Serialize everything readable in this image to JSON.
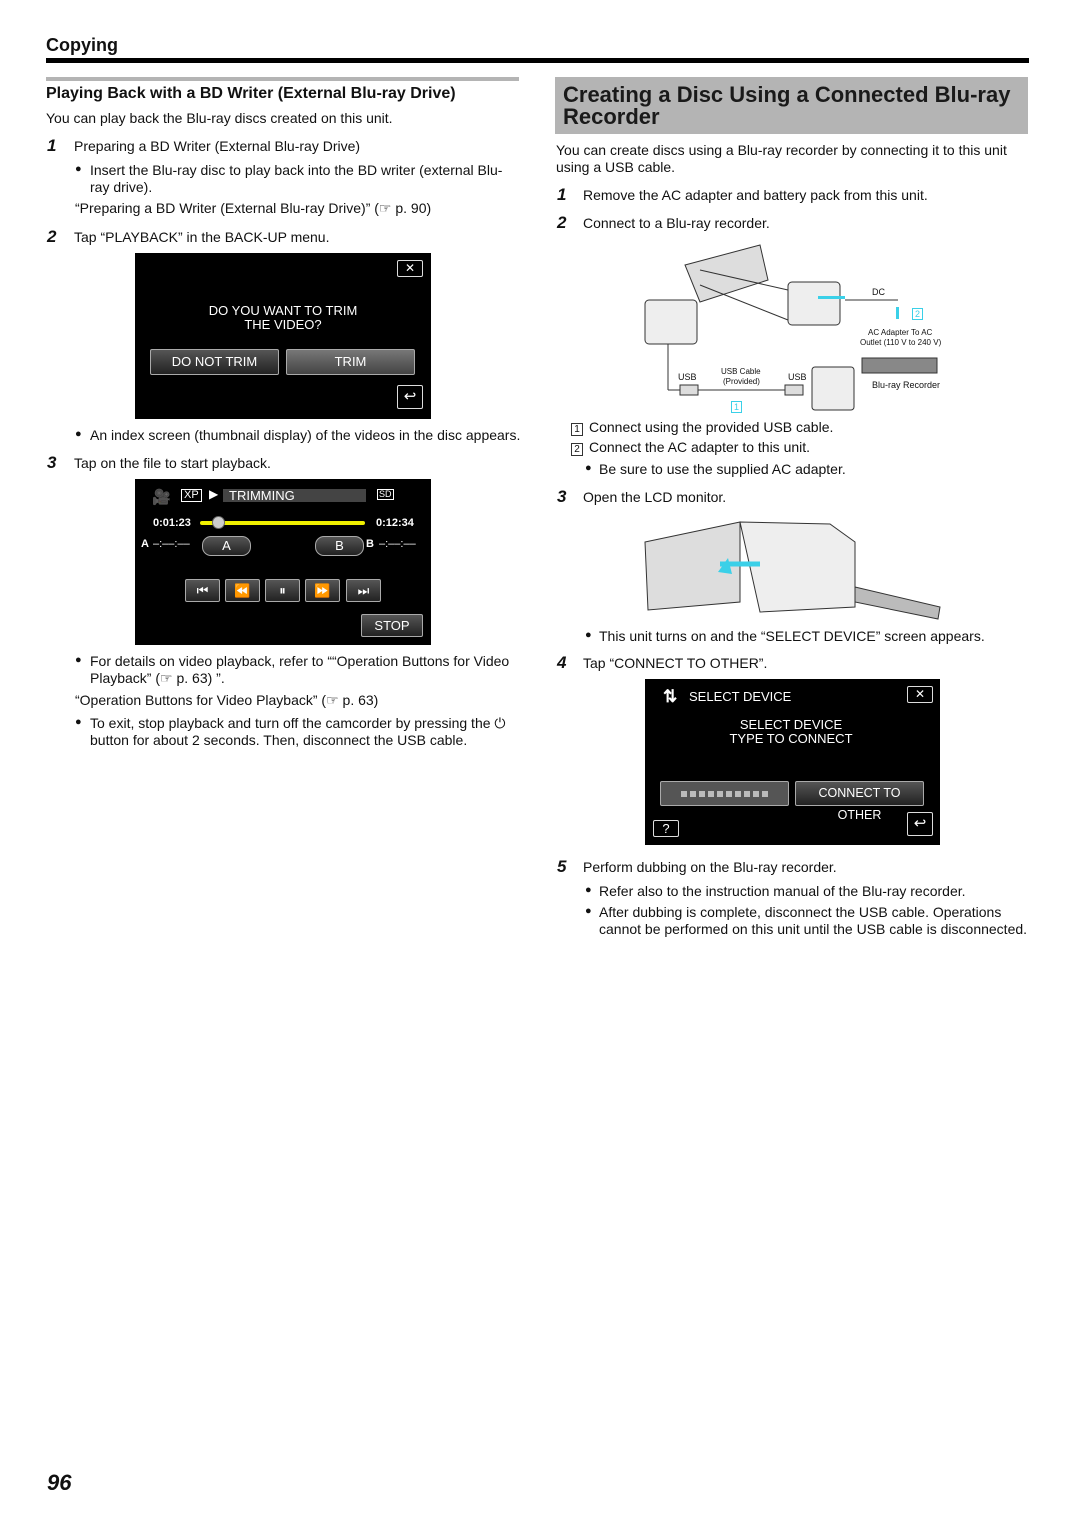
{
  "header": {
    "section": "Copying"
  },
  "left": {
    "title": "Playing Back with a BD Writer (External Blu-ray Drive)",
    "intro": "You can play back the Blu-ray discs created on this unit.",
    "step1": {
      "num": "1",
      "text": "Preparing a BD Writer (External Blu-ray Drive)",
      "bullet1": "Insert the Blu-ray disc to play back into the BD writer (external Blu-",
      "bullet1b": "ray drive).",
      "ref": "“Preparing a BD Writer (External Blu-ray Drive)” (☞ p. 90)"
    },
    "step2": {
      "num": "2",
      "text": "Tap “PLAYBACK” in the BACK-UP menu.",
      "bullet": "An index screen (thumbnail display) of the videos in the disc appears."
    },
    "screen1": {
      "message1": "DO YOU WANT TO TRIM",
      "message2": "THE VIDEO?",
      "btn_no": "DO NOT TRIM",
      "btn_yes": "TRIM"
    },
    "step3": {
      "num": "3",
      "text": "Tap on the file to start playback.",
      "bullet1": "For details on video playback, refer to ““Operation Buttons for Video",
      "bullet1b": "Playback” (☞ p. 63) ”.",
      "ref": "“Operation Buttons for Video Playback” (☞ p. 63)",
      "bullet2": "To exit, stop playback and turn off the camcorder by pressing the ⏻",
      "bullet2b": "button for about 2 seconds. Then, disconnect the USB cable."
    },
    "screen2": {
      "quality": "XP",
      "mode": "TRIMMING",
      "media": "SD",
      "time_current": "0:01:23",
      "time_total": "0:12:34",
      "progress": 0.11,
      "a_label": "A",
      "a_value": "–:––:––",
      "b_label": "B",
      "b_value": "–:––:––",
      "btn_a": "A",
      "btn_b": "B",
      "stop": "STOP"
    }
  },
  "right": {
    "title1": "Creating a Disc Using a Connected Blu-ray",
    "title2": "Recorder",
    "intro1": "You can create discs using a Blu-ray recorder by connecting it to this unit",
    "intro2": "using a USB cable.",
    "step1": {
      "num": "1",
      "text": "Remove the AC adapter and battery pack from this unit."
    },
    "step2": {
      "num": "2",
      "text": "Connect to a Blu-ray recorder.",
      "sub1_num": "1",
      "sub1": "Connect using the provided USB cable.",
      "sub2_num": "2",
      "sub2": "Connect the AC adapter to this unit.",
      "bullet": "Be sure to use the supplied AC adapter."
    },
    "diagram": {
      "dc": "DC",
      "ac1": "AC Adapter To AC",
      "ac2": "Outlet (110 V to 240 V)",
      "usb_left": "USB",
      "cable1": "USB Cable",
      "cable2": "(Provided)",
      "usb_right": "USB",
      "recorder": "Blu-ray Recorder",
      "mark1": "1",
      "mark2": "2"
    },
    "step3": {
      "num": "3",
      "text": "Open the LCD monitor.",
      "bullet": "This unit turns on and the “SELECT DEVICE” screen appears."
    },
    "step4": {
      "num": "4",
      "text": "Tap “CONNECT TO OTHER”."
    },
    "screen3": {
      "title": "SELECT DEVICE",
      "msg1": "SELECT DEVICE",
      "msg2": "TYPE TO CONNECT",
      "btn_other": "CONNECT TO OTHER",
      "help": "?"
    },
    "step5": {
      "num": "5",
      "text": "Perform dubbing on the Blu-ray recorder.",
      "bullet1": "Refer also to the instruction manual of the Blu-ray recorder.",
      "bullet2": "After dubbing is complete, disconnect the USB cable. Operations",
      "bullet2b": "cannot be performed on this unit until the USB cable is disconnected."
    }
  },
  "footer": {
    "page": "96"
  },
  "colors": {
    "heading_bg": "#b4b4b4",
    "highlight_cyan": "#3ad0e8",
    "slider_yellow": "#f0f000"
  }
}
